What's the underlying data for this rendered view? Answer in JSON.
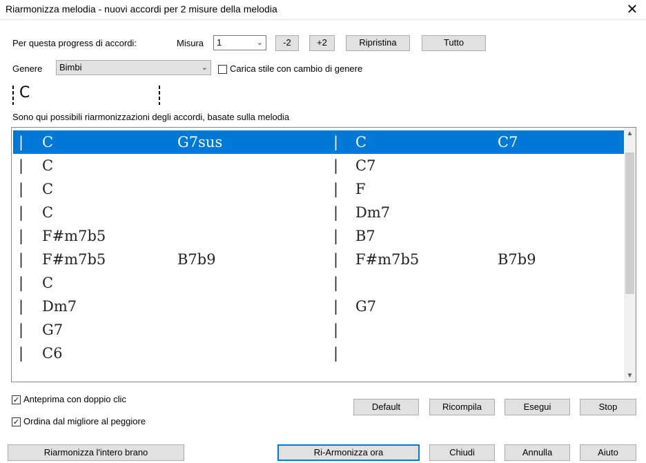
{
  "window": {
    "title": "Riarmonizza melodia - nuovi accordi per 2 misure della melodia",
    "close_glyph": "✕"
  },
  "toolbar": {
    "progress_label": "Per questa progress di accordi:",
    "measure_label": "Misura",
    "measure_value": "1",
    "minus2_label": "-2",
    "plus2_label": "+2",
    "reset_label": "Ripristina",
    "all_label": "Tutto"
  },
  "genre": {
    "label": "Genere",
    "value": "Bimbi",
    "load_style_label": "Carica stile con cambio di genere",
    "load_style_checked": false
  },
  "current_chord": "C",
  "list_caption": "Sono qui possibili riarmonizzazioni degli accordi, basate sulla melodia",
  "rows": [
    {
      "a": "C",
      "b": "G7sus",
      "c": "C",
      "d": "C7",
      "selected": true
    },
    {
      "a": "C",
      "b": "",
      "c": "C7",
      "d": "",
      "selected": false
    },
    {
      "a": "C",
      "b": "",
      "c": "F",
      "d": "",
      "selected": false
    },
    {
      "a": "C",
      "b": "",
      "c": "Dm7",
      "d": "",
      "selected": false
    },
    {
      "a": "F#m7b5",
      "b": "",
      "c": "B7",
      "d": "",
      "selected": false
    },
    {
      "a": "F#m7b5",
      "b": "B7b9",
      "c": "F#m7b5",
      "d": "B7b9",
      "selected": false
    },
    {
      "a": "C",
      "b": "",
      "c": "",
      "d": "",
      "selected": false
    },
    {
      "a": "Dm7",
      "b": "",
      "c": "G7",
      "d": "",
      "selected": false
    },
    {
      "a": "G7",
      "b": "",
      "c": "",
      "d": "",
      "selected": false
    },
    {
      "a": "C6",
      "b": "",
      "c": "",
      "d": "",
      "selected": false
    }
  ],
  "bar_glyph": "|",
  "options": {
    "preview_label": "Anteprima con doppio clic",
    "preview_checked": true,
    "sort_label": "Ordina dal migliore al peggiore",
    "sort_checked": true
  },
  "buttons": {
    "default_label": "Default",
    "recompile_label": "Ricompila",
    "run_label": "Esegui",
    "stop_label": "Stop",
    "reharm_all_label": "Riarmonizza l'intero brano",
    "reharm_now_label": "Ri-Armonizza ora",
    "close_label": "Chiudi",
    "cancel_label": "Annulla",
    "help_label": "Aiuto"
  },
  "icons": {
    "dropdown": "chevron-down-icon",
    "check": "✓",
    "scroll_up": "▲",
    "scroll_down": "▼"
  },
  "colors": {
    "selection": "#0078d7",
    "button_face": "#e1e1e1"
  }
}
